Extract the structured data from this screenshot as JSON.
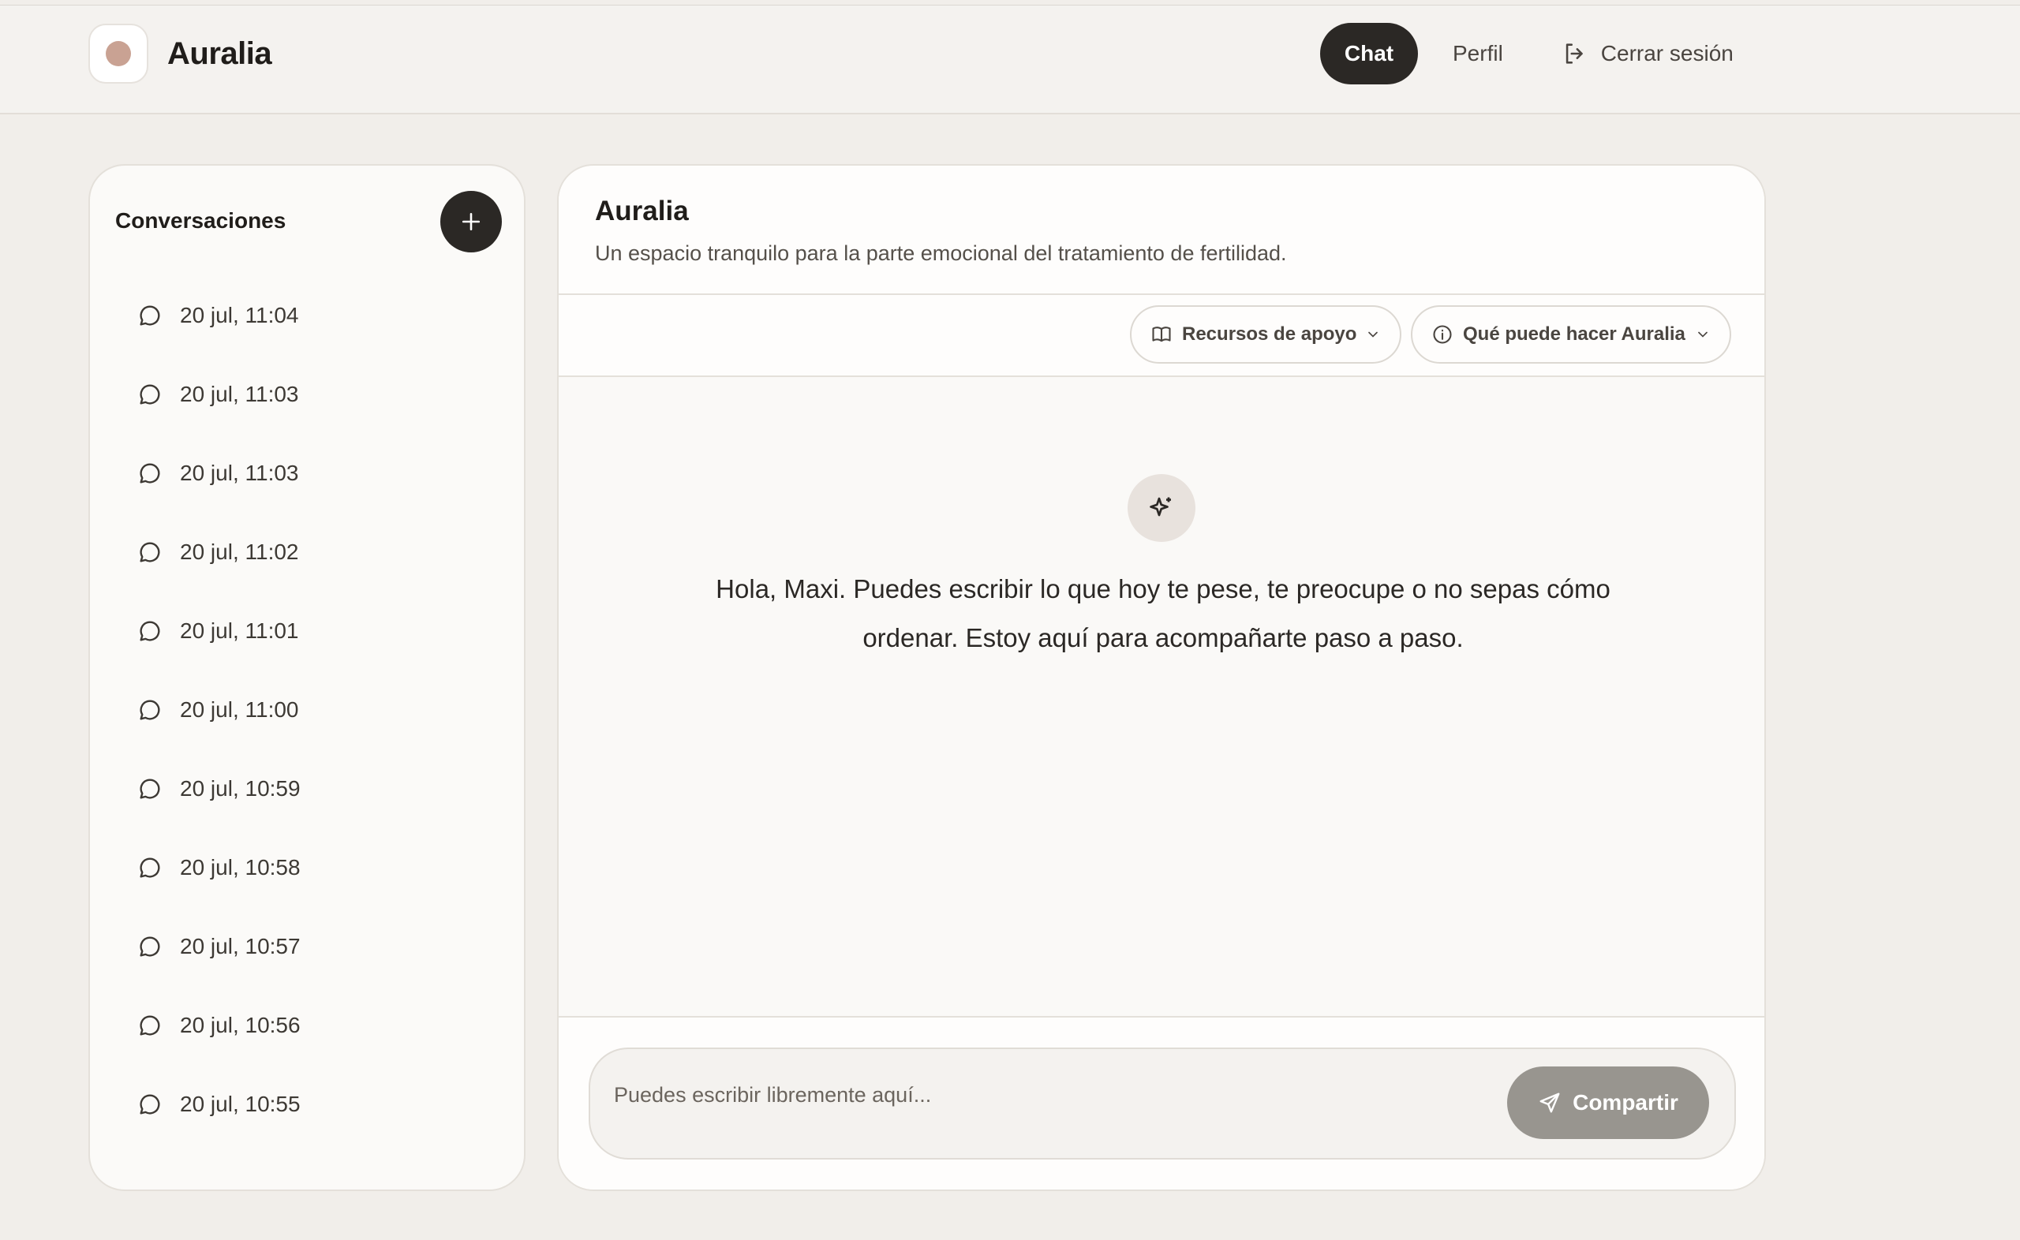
{
  "app": {
    "name": "Auralia"
  },
  "nav": {
    "chat": "Chat",
    "profile": "Perfil",
    "logout": "Cerrar sesión"
  },
  "sidebar": {
    "title": "Conversaciones",
    "items": [
      "20 jul, 11:04",
      "20 jul, 11:03",
      "20 jul, 11:03",
      "20 jul, 11:02",
      "20 jul, 11:01",
      "20 jul, 11:00",
      "20 jul, 10:59",
      "20 jul, 10:58",
      "20 jul, 10:57",
      "20 jul, 10:56",
      "20 jul, 10:55"
    ]
  },
  "main": {
    "title": "Auralia",
    "subtitle": "Un espacio tranquilo para la parte emocional del tratamiento de fertilidad.",
    "toolbar": {
      "resources": "Recursos de apoyo",
      "about": "Qué puede hacer Auralia"
    },
    "welcome": "Hola, Maxi. Puedes escribir lo que hoy te pese, te preocupe o no sepas cómo ordenar. Estoy aquí para acompañarte paso a paso.",
    "composer": {
      "placeholder": "Puedes escribir libremente aquí...",
      "send": "Compartir"
    }
  },
  "colors": {
    "accent": "#2b2825",
    "brand_dot": "#c9a293",
    "send_disabled": "#98958f"
  }
}
